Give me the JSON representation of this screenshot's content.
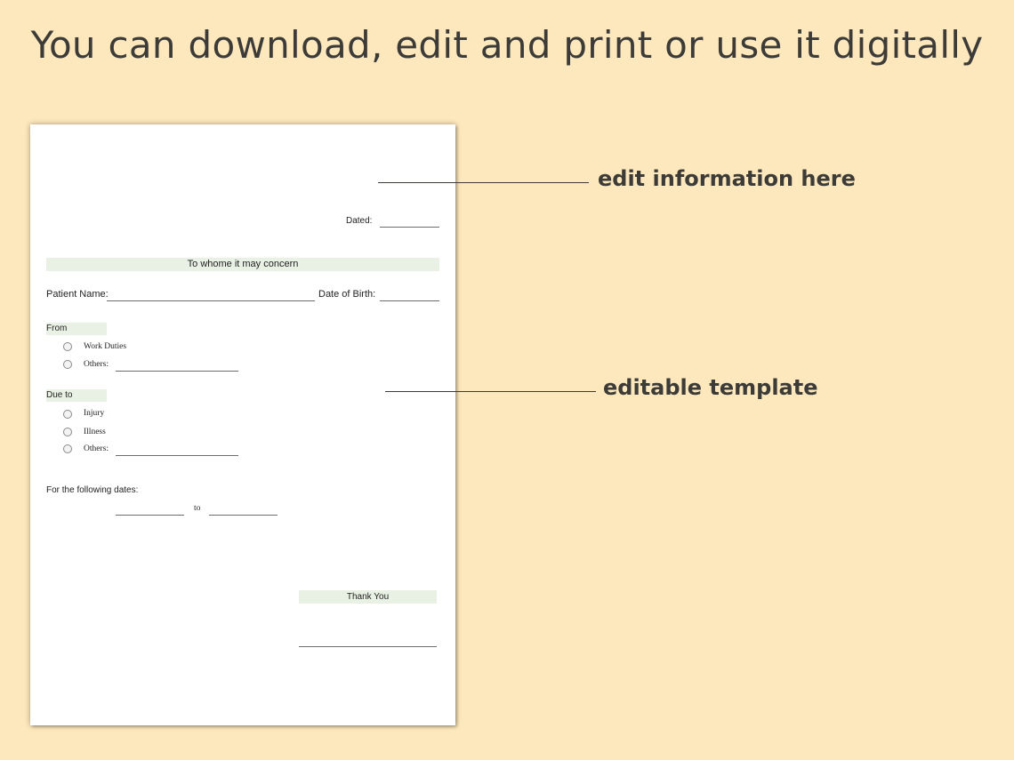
{
  "headline": "You can download, edit and print or use it digitally",
  "callouts": {
    "edit_info": "edit information here",
    "editable_template": "editable template"
  },
  "form": {
    "dated_label": "Dated:",
    "greeting": "To whome it may concern",
    "patient_name_label": "Patient Name:",
    "dob_label": "Date of Birth:",
    "from_label": "From",
    "from_options": [
      "Work Duties",
      "Others:"
    ],
    "due_to_label": "Due to",
    "due_to_options": [
      "Injury",
      "Illness",
      "Others:"
    ],
    "dates_label": "For the following dates:",
    "to_label": "to",
    "thank_you": "Thank You"
  },
  "colors": {
    "background": "#fde8bd",
    "band": "#e9f1e4",
    "text": "#3c3b37"
  }
}
